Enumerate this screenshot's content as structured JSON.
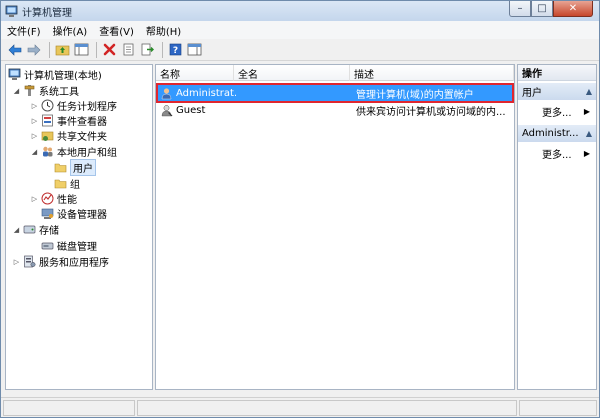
{
  "window": {
    "title": "计算机管理",
    "controls": {
      "minimize": "–",
      "maximize": "□",
      "close": "✕"
    }
  },
  "menubar": {
    "items": [
      "文件(F)",
      "操作(A)",
      "查看(V)",
      "帮助(H)"
    ]
  },
  "tree": {
    "items": [
      {
        "label": "计算机管理(本地)",
        "icon": "computer-management-icon"
      },
      {
        "label": "系统工具",
        "icon": "tools-icon"
      },
      {
        "label": "任务计划程序",
        "icon": "clock-icon"
      },
      {
        "label": "事件查看器",
        "icon": "event-viewer-icon"
      },
      {
        "label": "共享文件夹",
        "icon": "shared-folder-icon"
      },
      {
        "label": "本地用户和组",
        "icon": "users-group-icon"
      },
      {
        "label": "用户",
        "icon": "folder-icon"
      },
      {
        "label": "组",
        "icon": "folder-icon"
      },
      {
        "label": "性能",
        "icon": "performance-icon"
      },
      {
        "label": "设备管理器",
        "icon": "device-manager-icon"
      },
      {
        "label": "存储",
        "icon": "storage-icon"
      },
      {
        "label": "磁盘管理",
        "icon": "disk-icon"
      },
      {
        "label": "服务和应用程序",
        "icon": "services-icon"
      }
    ]
  },
  "list": {
    "columns": [
      "名称",
      "全名",
      "描述"
    ],
    "rows": [
      {
        "name": "Administrat...",
        "fullname": "",
        "description": "管理计算机(域)的内置帐户"
      },
      {
        "name": "Guest",
        "fullname": "",
        "description": "供来宾访问计算机或访问域的内..."
      }
    ]
  },
  "actions": {
    "header": "操作",
    "groups": [
      {
        "title": "用户",
        "item": "更多..."
      },
      {
        "title": "Administr...",
        "item": "更多..."
      }
    ]
  },
  "colors": {
    "selection": "#3399ff",
    "highlight_border": "#e0262f",
    "pane_border": "#a8b4c4"
  }
}
